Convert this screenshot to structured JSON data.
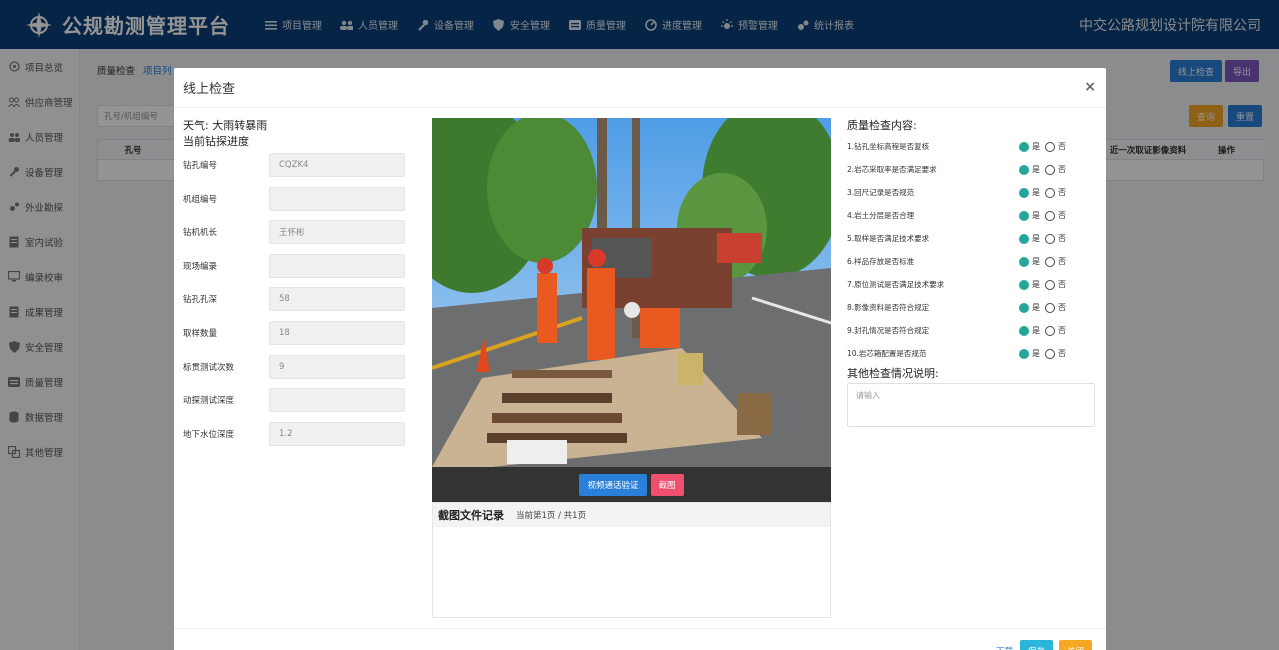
{
  "app": {
    "title": "公规勘测管理平台",
    "company": "中交公路规划设计院有限公司"
  },
  "topnav": [
    {
      "label": "项目管理",
      "icon": "list-icon"
    },
    {
      "label": "人员管理",
      "icon": "users-icon"
    },
    {
      "label": "设备管理",
      "icon": "wrench-icon"
    },
    {
      "label": "安全管理",
      "icon": "shield-icon"
    },
    {
      "label": "质量管理",
      "icon": "quality-icon"
    },
    {
      "label": "进度管理",
      "icon": "gauge-icon"
    },
    {
      "label": "预警管理",
      "icon": "alert-light-icon"
    },
    {
      "label": "统计报表",
      "icon": "chart-icon"
    }
  ],
  "sidebar": [
    {
      "label": "项目总览",
      "icon": "overview-icon"
    },
    {
      "label": "供应商管理",
      "icon": "supplier-icon"
    },
    {
      "label": "人员管理",
      "icon": "users-icon"
    },
    {
      "label": "设备管理",
      "icon": "wrench-icon"
    },
    {
      "label": "外业勘探",
      "icon": "field-icon"
    },
    {
      "label": "室内试验",
      "icon": "lab-icon"
    },
    {
      "label": "编录校审",
      "icon": "monitor-icon"
    },
    {
      "label": "成果管理",
      "icon": "result-icon"
    },
    {
      "label": "安全管理",
      "icon": "shield-icon"
    },
    {
      "label": "质量管理",
      "icon": "quality-icon"
    },
    {
      "label": "数据管理",
      "icon": "database-icon"
    },
    {
      "label": "其他管理",
      "icon": "other-icon"
    }
  ],
  "background": {
    "breadcrumb_1": "质量检查",
    "breadcrumb_2": "项目列",
    "btn_online": "线上检查",
    "btn_export": "导出",
    "search_placeholder": "孔号/机组编号",
    "btn_query": "查询",
    "btn_reset": "重置",
    "col_hole": "孔号",
    "col_recent": "近一次取证影像资料",
    "col_action": "操作"
  },
  "modal": {
    "title": "线上检查",
    "close": "×",
    "weather": "天气: 大雨转暴雨",
    "progress_title": "当前钻探进度",
    "fields": [
      {
        "label": "钻孔编号",
        "value": "CQZK4"
      },
      {
        "label": "机组编号",
        "value": ""
      },
      {
        "label": "钻机机长",
        "value": "王怀彬"
      },
      {
        "label": "现场编录",
        "value": ""
      },
      {
        "label": "钻孔孔深",
        "value": "58"
      },
      {
        "label": "取样数量",
        "value": "18"
      },
      {
        "label": "标贯测试次数",
        "value": "9"
      },
      {
        "label": "动探测试深度",
        "value": ""
      },
      {
        "label": "地下水位深度",
        "value": "1.2"
      }
    ],
    "video_verify_button": "视频通话验证",
    "screenshot_button": "截图",
    "shot_record_title": "截图文件记录",
    "shot_record_page": "当前第1页 / 共1页",
    "qc_title": "质量检查内容:",
    "qc_items": [
      {
        "label": "1.钻孔坐标高程是否复核",
        "yes": "是",
        "no": "否"
      },
      {
        "label": "2.岩芯采取率是否满足要求",
        "yes": "是",
        "no": "否"
      },
      {
        "label": "3.回尺记录是否规范",
        "yes": "是",
        "no": "否"
      },
      {
        "label": "4.岩土分层是否合理",
        "yes": "是",
        "no": "否"
      },
      {
        "label": "5.取样是否满足技术要求",
        "yes": "是",
        "no": "否"
      },
      {
        "label": "6.样品存放是否标准",
        "yes": "是",
        "no": "否"
      },
      {
        "label": "7.原位测试是否满足技术要求",
        "yes": "是",
        "no": "否"
      },
      {
        "label": "8.影像资料是否符合规定",
        "yes": "是",
        "no": "否"
      },
      {
        "label": "9.封孔情况是否符合规定",
        "yes": "是",
        "no": "否"
      },
      {
        "label": "10.岩芯箱配置是否规范",
        "yes": "是",
        "no": "否"
      }
    ],
    "other_title": "其他检查情况说明:",
    "other_placeholder": "请输入",
    "footer_download": "下载",
    "footer_save": "保存",
    "footer_close": "关闭"
  },
  "colors": {
    "header": "#0b3f77",
    "accent_teal": "#26a69a",
    "btn_blue": "#2a7fd8",
    "btn_red": "#f0506e",
    "btn_purple": "#7e57c2",
    "btn_orange": "#f5a623",
    "btn_cyan": "#29b6d8"
  }
}
